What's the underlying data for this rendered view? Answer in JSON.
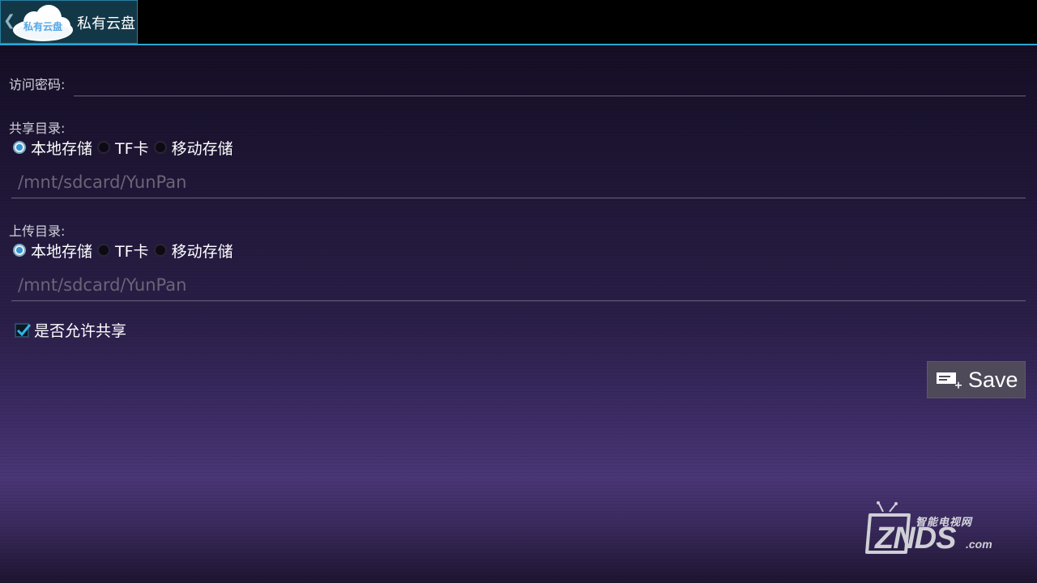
{
  "app": {
    "title": "私有云盘",
    "icon_text": "私有云盘",
    "up_glyph": "❮"
  },
  "form": {
    "password_label": "访问密码:",
    "password_value": "",
    "share": {
      "label": "共享目录:",
      "options": [
        "本地存储",
        "TF卡",
        "移动存储"
      ],
      "selected": "本地存储",
      "path": "/mnt/sdcard/YunPan"
    },
    "upload": {
      "label": "上传目录:",
      "options": [
        "本地存储",
        "TF卡",
        "移动存储"
      ],
      "selected": "本地存储",
      "path": "/mnt/sdcard/YunPan"
    },
    "allow_share": {
      "label": "是否允许共享",
      "checked": true
    }
  },
  "actions": {
    "save_label": "Save"
  },
  "watermark": {
    "top": "智能电视网",
    "main": "ZNDS",
    "suffix": ".com"
  },
  "colors": {
    "accent": "#2aa6d6",
    "radio_checked": "#2f96d1",
    "check": "#33b5e5"
  }
}
